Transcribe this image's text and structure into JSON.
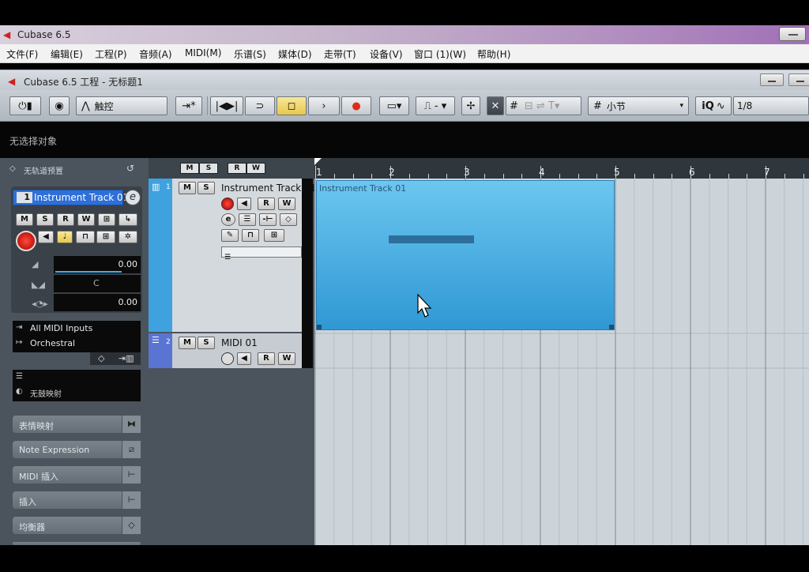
{
  "window": {
    "title": "Cubase 6.5"
  },
  "menu": [
    "文件(F)",
    "编辑(E)",
    "工程(P)",
    "音频(A)",
    "MIDI(M)",
    "乐谱(S)",
    "媒体(D)",
    "走带(T)",
    "设备(V)",
    "窗口 (1)(W)",
    "帮助(H)"
  ],
  "project": {
    "title": "Cubase 6.5 工程 - 无标题1"
  },
  "toolbar": {
    "touch_mode": "触控",
    "snap_type": "小节",
    "quantize": "1/8",
    "iq_label": "iQ",
    "grid_label": "#",
    "x_label": "✕"
  },
  "info_line": {
    "text": "无选择对象"
  },
  "inspector": {
    "preset_label": "无轨道预置",
    "track_number": "1",
    "track_name": "Instrument Track 01",
    "volume": "0.00",
    "pan": "C",
    "delay": "0.00",
    "input": "All MIDI Inputs",
    "output": "Orchestral",
    "map_label": "无鼓映射",
    "sections": [
      "表情映射",
      "Note Expression",
      "MIDI 插入",
      "插入",
      "均衡器"
    ]
  },
  "track_header_buttons": [
    "M",
    "S",
    "R",
    "W"
  ],
  "tracks": [
    {
      "number": "1",
      "name": "Instrument Track 01"
    },
    {
      "number": "2",
      "name": "MIDI 01"
    }
  ],
  "ruler": {
    "bars": [
      "1",
      "2",
      "3",
      "4",
      "5",
      "6",
      "7"
    ]
  },
  "part": {
    "name": "Instrument Track 01"
  },
  "colors": {
    "instrument_track": "#3fa2df",
    "midi_track": "#5a74d2",
    "part": "#4fb2e6",
    "record": "#e02a1a"
  }
}
